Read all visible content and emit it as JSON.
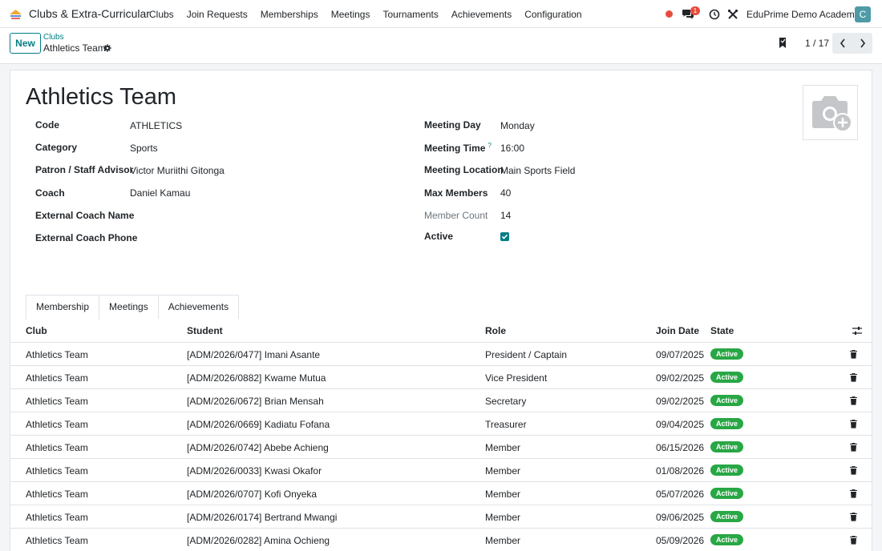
{
  "app": {
    "name": "Clubs & Extra-Curricular"
  },
  "menu": [
    "Clubs",
    "Join Requests",
    "Memberships",
    "Meetings",
    "Tournaments",
    "Achievements",
    "Configuration"
  ],
  "systray": {
    "chat_count": "1",
    "company": "EduPrime Demo Academy",
    "avatar_letter": "C"
  },
  "control": {
    "new_label": "New",
    "breadcrumb_parent": "Clubs",
    "breadcrumb_current": "Athletics Team",
    "pager": "1 / 17"
  },
  "record": {
    "title": "Athletics Team",
    "left_fields": [
      {
        "label": "Code",
        "value": "ATHLETICS"
      },
      {
        "label": "Category",
        "value": "Sports"
      },
      {
        "label": "Patron / Staff Advisor",
        "value": "Victor Muriithi Gitonga"
      },
      {
        "label": "Coach",
        "value": "Daniel Kamau"
      },
      {
        "label": "External Coach Name",
        "value": ""
      },
      {
        "label": "External Coach Phone",
        "value": ""
      }
    ],
    "right_fields": [
      {
        "label": "Meeting Day",
        "value": "Monday"
      },
      {
        "label": "Meeting Time",
        "value": "16:00",
        "help": "?"
      },
      {
        "label": "Meeting Location",
        "value": "Main Sports Field"
      },
      {
        "label": "Max Members",
        "value": "40"
      },
      {
        "label": "Member Count",
        "value": "14"
      },
      {
        "label": "Active",
        "value": ""
      }
    ],
    "active": true
  },
  "tabs": [
    "Membership",
    "Meetings",
    "Achievements"
  ],
  "table": {
    "columns": [
      "Club",
      "Student",
      "Role",
      "Join Date",
      "State"
    ],
    "rows": [
      {
        "club": "Athletics Team",
        "student": "[ADM/2026/0477] Imani Asante",
        "role": "President / Captain",
        "join_date": "09/07/2025",
        "state": "Active"
      },
      {
        "club": "Athletics Team",
        "student": "[ADM/2026/0882] Kwame Mutua",
        "role": "Vice President",
        "join_date": "09/02/2025",
        "state": "Active"
      },
      {
        "club": "Athletics Team",
        "student": "[ADM/2026/0672] Brian Mensah",
        "role": "Secretary",
        "join_date": "09/02/2025",
        "state": "Active"
      },
      {
        "club": "Athletics Team",
        "student": "[ADM/2026/0669] Kadiatu Fofana",
        "role": "Treasurer",
        "join_date": "09/04/2025",
        "state": "Active"
      },
      {
        "club": "Athletics Team",
        "student": "[ADM/2026/0742] Abebe Achieng",
        "role": "Member",
        "join_date": "06/15/2026",
        "state": "Active"
      },
      {
        "club": "Athletics Team",
        "student": "[ADM/2026/0033] Kwasi Okafor",
        "role": "Member",
        "join_date": "01/08/2026",
        "state": "Active"
      },
      {
        "club": "Athletics Team",
        "student": "[ADM/2026/0707] Kofi Onyeka",
        "role": "Member",
        "join_date": "05/07/2026",
        "state": "Active"
      },
      {
        "club": "Athletics Team",
        "student": "[ADM/2026/0174] Bertrand Mwangi",
        "role": "Member",
        "join_date": "09/06/2025",
        "state": "Active"
      },
      {
        "club": "Athletics Team",
        "student": "[ADM/2026/0282] Amina Ochieng",
        "role": "Member",
        "join_date": "05/09/2026",
        "state": "Active"
      }
    ]
  },
  "colors": {
    "accent": "#017e84",
    "success": "#28a745",
    "danger": "#e74c3c"
  }
}
